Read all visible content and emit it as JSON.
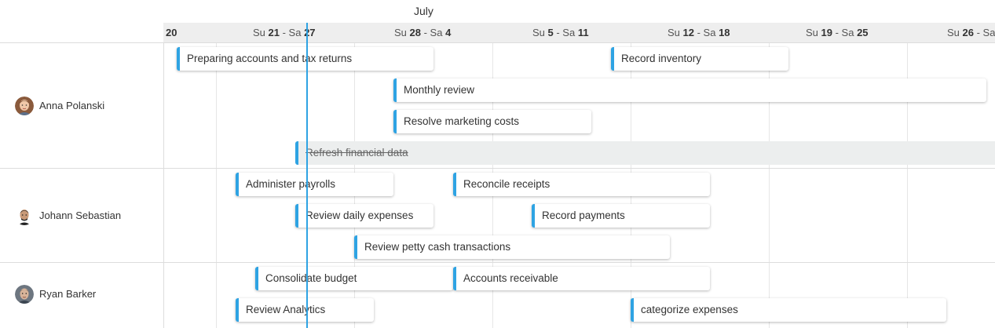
{
  "timeline": {
    "month": "July",
    "weeks": [
      {
        "pre": "",
        "start": "20",
        "mid": "",
        "end": ""
      },
      {
        "pre": "Su ",
        "start": "21",
        "mid": " - Sa ",
        "end": "27"
      },
      {
        "pre": "Su ",
        "start": "28",
        "mid": " - Sa ",
        "end": "4"
      },
      {
        "pre": "Su ",
        "start": "5",
        "mid": " - Sa ",
        "end": "11"
      },
      {
        "pre": "Su ",
        "start": "12",
        "mid": " - Sa ",
        "end": "18"
      },
      {
        "pre": "Su ",
        "start": "19",
        "mid": " - Sa ",
        "end": "25"
      },
      {
        "pre": "Su ",
        "start": "26",
        "mid": " - Sa",
        "end": ""
      }
    ]
  },
  "resources": [
    {
      "name": "Anna Polanski",
      "avatar": "avatar-woman-icon"
    },
    {
      "name": "Johann Sebastian",
      "avatar": "avatar-man-icon"
    },
    {
      "name": "Ryan Barker",
      "avatar": "avatar-man-icon"
    }
  ],
  "tasks": [
    {
      "label": "Preparing accounts and tax returns",
      "resource": 0,
      "done": false
    },
    {
      "label": "Record inventory",
      "resource": 0,
      "done": false
    },
    {
      "label": "Monthly review",
      "resource": 0,
      "done": false
    },
    {
      "label": "Resolve marketing costs",
      "resource": 0,
      "done": false
    },
    {
      "label": "Refresh financial data",
      "resource": 0,
      "done": true
    },
    {
      "label": "Administer payrolls",
      "resource": 1,
      "done": false
    },
    {
      "label": "Reconcile receipts",
      "resource": 1,
      "done": false
    },
    {
      "label": "Review daily expenses",
      "resource": 1,
      "done": false
    },
    {
      "label": "Record payments",
      "resource": 1,
      "done": false
    },
    {
      "label": "Review petty cash transactions",
      "resource": 1,
      "done": false
    },
    {
      "label": "Consolidate budget",
      "resource": 2,
      "done": false
    },
    {
      "label": "Accounts receivable",
      "resource": 2,
      "done": false
    },
    {
      "label": "Review Analytics",
      "resource": 2,
      "done": false
    },
    {
      "label": "categorize expenses",
      "resource": 2,
      "done": false
    }
  ],
  "colors": {
    "accent": "#2ea3e3",
    "done_bg": "#eceeee"
  }
}
